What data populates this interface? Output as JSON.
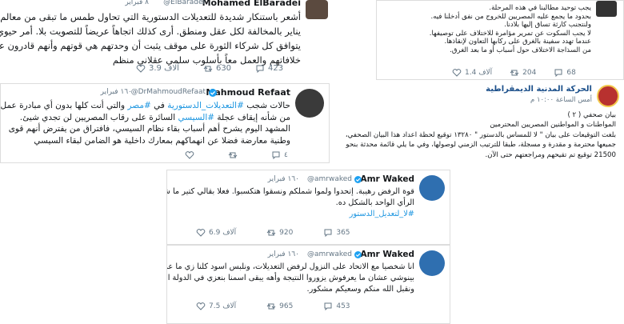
{
  "colors": {
    "link": "#1b95e0",
    "muted": "#657786",
    "text": "#14171a",
    "verified": "#1da1f2"
  },
  "t1": {
    "name": "Mohamed ElBaradei",
    "handle": "@ElBaradei",
    "date": "٨ فبراير",
    "lines": [
      "أشعر باستنكار شديدة للتعديلات الدستورية التي تحاول طمس ما تبقى من معالم ٢٥",
      "يناير بالمخالفة لكل عقل ومنطق. أرى كذلك اتجاهاً عريضاً للتصويت بلا. أمر حيوي أن",
      "يتوافق كل شركاء الثورة على موقف يثبت أن وحدتهم هي قوتهم وأنهم قادرون على نبذ",
      "خلافاتهم والعمل معاً بأسلوب سلمي عقلاني منظم"
    ],
    "replies": "423",
    "retweets": "630",
    "likes": "3.9 آلاف"
  },
  "t2": {
    "lines": [
      "يجب توحيد مطالبنا في هذه المرحلة.",
      "بحدود ما يجمع عليه المصريين للخروج من نفق أدخلنا فيه.",
      "ولنتجنب كارثة تساق إليها بلادنا.",
      "لا يجب السكوت عن تمرير مؤامرة للاختلاف على توصيفها.",
      "عندما تهدد سفينة بالغرق على ركابها التعاون لإنقاذها.",
      "من السذاجة الاختلاف حول أسباب أو ما بعد الغرق."
    ],
    "replies": "68",
    "retweets": "204",
    "likes": "1.4 آلاف"
  },
  "t3": {
    "name": "Mahmoud Refaat",
    "handle": "@DrMahmoudRefaat",
    "date": "١٦٠ فبراير",
    "lines": [
      [
        "حالات شجب ",
        "#التعديلات_الدستورية",
        " في ",
        "#مصر",
        " والتي أنت كلها بدون أي مبادرة عمل جاد"
      ],
      [
        "من شأنه إيقاف عجلة ",
        "#السيسي",
        " السائرة على رقاب المصريين لن تجدي شيئ."
      ],
      [
        "المشهد اليوم يشرح أهم أسباب بقاء نظام السيسي، فافتراق من يفترض أنهم قوى"
      ],
      [
        "وطنية معارضة فضلا عن انهماكهم بمعارك داخلية هو الضامن لبقاء السيسي"
      ]
    ],
    "replies": "٤",
    "retweets": "",
    "likes": ""
  },
  "t4": {
    "name": "الحركة المدنية الديمقراطية",
    "time": "أمس الساعة ١٠:٠٠ م",
    "lines": [
      "بيان صحفي ( ٢ )",
      "المواطنات و المواطنين المصريين المحترمين",
      "بلغت التوقيعات على بيان \" لا للمساس بالدستور \" ١٣٢٨٠ توقيع لحظة اعداد هذا البيان الصحفي،",
      "جميعها محترمة و مقدرة و مسجلة، طبقا للترتيب الزمني لوصولها، وفي ما يلي قائمة محدثة بنحو",
      "21500 توقيع تم تقيحهم ومراجعتهم حتى الآن."
    ]
  },
  "t5": {
    "name": "Amr Waked",
    "handle": "@amrwaked",
    "date": "١٦٠ فبراير",
    "lines": [
      "قوة الرفض رهيبة. إتحدوا ولموا شملكم ونسقوا هتكسبوا. فعلا بقالي كتير ما شوفتش",
      "الرأي الواحد بالشكل ده."
    ],
    "hashtag": "#لا_لتعديل_الدستور",
    "replies": "365",
    "retweets": "920",
    "likes": "6.9 آلاف"
  },
  "t6": {
    "name": "Amr Waked",
    "handle": "@amrwaked",
    "date": "١٦٠ فبراير",
    "lines": [
      "انا شخصيا مع الاتحاد على النزول لرفض التعديلات، ونلبس اسود كلنا زي ما عملوا مع",
      "بينوشي عشان ما يعرفوش يزوروا النتيجة وأهه يبقى اسمنا بنعزي في الدولة القديمة",
      "ونقبل الله منكم وسعيكم مشكور."
    ],
    "replies": "453",
    "retweets": "965",
    "likes": "7.5 آلاف"
  }
}
